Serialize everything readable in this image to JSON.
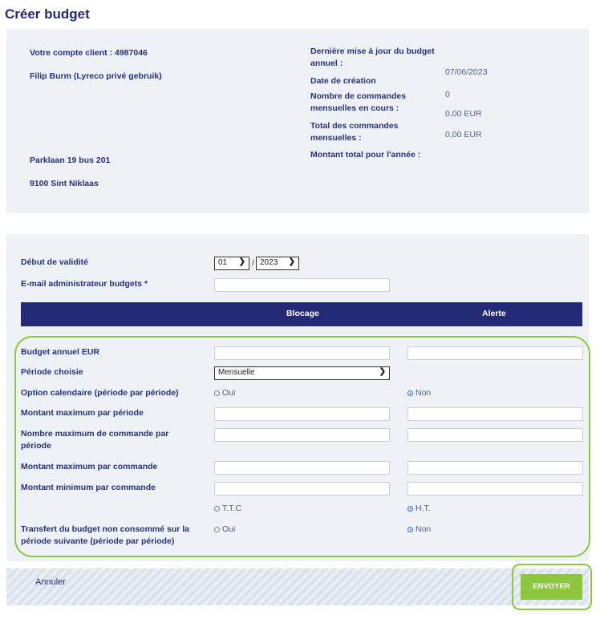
{
  "page": {
    "title": "Créer budget"
  },
  "account": {
    "client_number": "Votre compte client : 4987046",
    "name": "Filip Burm (Lyreco privé gebruik)",
    "street": "Parklaan 19 bus 201",
    "city": "9100 Sint Niklaas"
  },
  "summary": {
    "last_update_label": "Dernière mise à jour du budget annuel :",
    "last_update_value": "07/06/2023",
    "creation_label": "Date de création",
    "orders_count_label": "Nombre de commandes mensuelles en cours :",
    "orders_count_value": "0",
    "monthly_total_label": "Total des commandes mensuelles :",
    "monthly_total_value": "0,00 EUR",
    "year_total_label": "Montant total pour l'année :",
    "year_total_value": "0,00 EUR"
  },
  "validity": {
    "label": "Début de validité",
    "month": "01",
    "separator": "/",
    "year": "2023"
  },
  "admin_email": {
    "label": "E-mail administrateur budgets *",
    "value": ""
  },
  "columns": {
    "blocking": "Blocage",
    "alert": "Alerte"
  },
  "fields": {
    "annual_budget": "Budget annuel EUR",
    "period": "Période choisie",
    "period_value": "Mensuelle",
    "calendar_option": "Option calendaire (période par période)",
    "max_per_period": "Montant maximum par période",
    "max_orders_per_period": "Nombre maximum de commande par période",
    "max_per_order": "Montant maximum par commande",
    "min_per_order": "Montant minimum par commande",
    "transfer": "Transfert du budget non consommé sur la période suivante (période par période)"
  },
  "radios": {
    "oui": "Oui",
    "non": "Non",
    "ttc": "T.T.C",
    "ht": "H.T.",
    "oui2": "Oui",
    "non2": "Non"
  },
  "footer": {
    "cancel": "Annuler",
    "send": "ENVOYER"
  },
  "colors": {
    "navy": "#242a78",
    "accent_green": "#8dc63f",
    "panel": "#eef2f6"
  }
}
